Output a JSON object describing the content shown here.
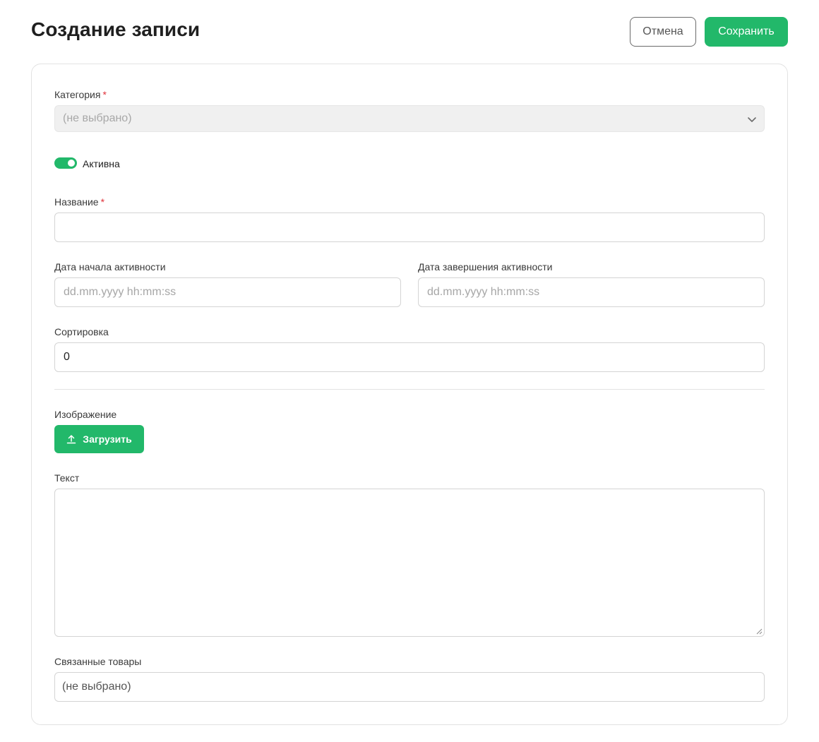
{
  "header": {
    "title": "Создание записи",
    "cancel_label": "Отмена",
    "save_label": "Сохранить"
  },
  "form": {
    "category": {
      "label": "Категория",
      "required_mark": "*",
      "value": "(не выбрано)",
      "disabled": true
    },
    "active": {
      "label": "Активна",
      "checked": true
    },
    "name": {
      "label": "Название",
      "required_mark": "*",
      "value": ""
    },
    "date_start": {
      "label": "Дата начала активности",
      "placeholder": "dd.mm.yyyy hh:mm:ss"
    },
    "date_end": {
      "label": "Дата завершения активности",
      "placeholder": "dd.mm.yyyy hh:mm:ss"
    },
    "sort": {
      "label": "Сортировка",
      "value": "0"
    },
    "image": {
      "label": "Изображение",
      "upload_label": "Загрузить"
    },
    "text": {
      "label": "Текст",
      "value": ""
    },
    "related": {
      "label": "Связанные товары",
      "value": "(не выбрано)"
    }
  },
  "colors": {
    "accent": "#22b86a",
    "required": "#e0323a",
    "border": "#d4d4d4"
  },
  "icons": [
    "chevron-down-icon",
    "upload-icon",
    "resize-grip-icon"
  ]
}
